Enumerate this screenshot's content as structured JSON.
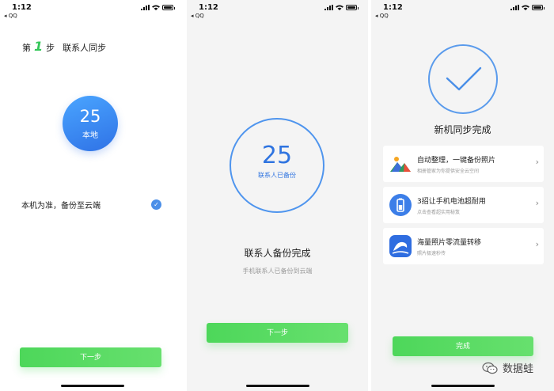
{
  "status": {
    "time": "1:12",
    "back_label": "◂ QQ"
  },
  "screen1": {
    "step_prefix": "第",
    "step_number": "1",
    "step_suffix": "步",
    "step_name": "联系人同步",
    "local_count": "25",
    "local_label": "本地",
    "option_label": "本机为准，备份至云端",
    "option_checked": true,
    "next_button": "下一步"
  },
  "screen2": {
    "backup_count": "25",
    "backup_label": "联系人已备份",
    "title": "联系人备份完成",
    "subtitle": "手机联系人已备份到云端",
    "next_button": "下一步"
  },
  "screen3": {
    "title": "新机同步完成",
    "cards": [
      {
        "icon": "photo-icon",
        "title": "自动整理，一键备份照片",
        "subtitle": "相册管家为你提供安全云空间"
      },
      {
        "icon": "battery-icon",
        "title": "3招让手机电池超耐用",
        "subtitle": "点击查看超实用秘笈"
      },
      {
        "icon": "sea-icon",
        "title": "海量照片零流量转移",
        "subtitle": "照片极速秒传"
      }
    ],
    "done_button": "完成"
  },
  "watermark": {
    "text": "数据蛙"
  },
  "colors": {
    "accent_green": "#4dd75a",
    "accent_blue": "#2f74e0"
  }
}
